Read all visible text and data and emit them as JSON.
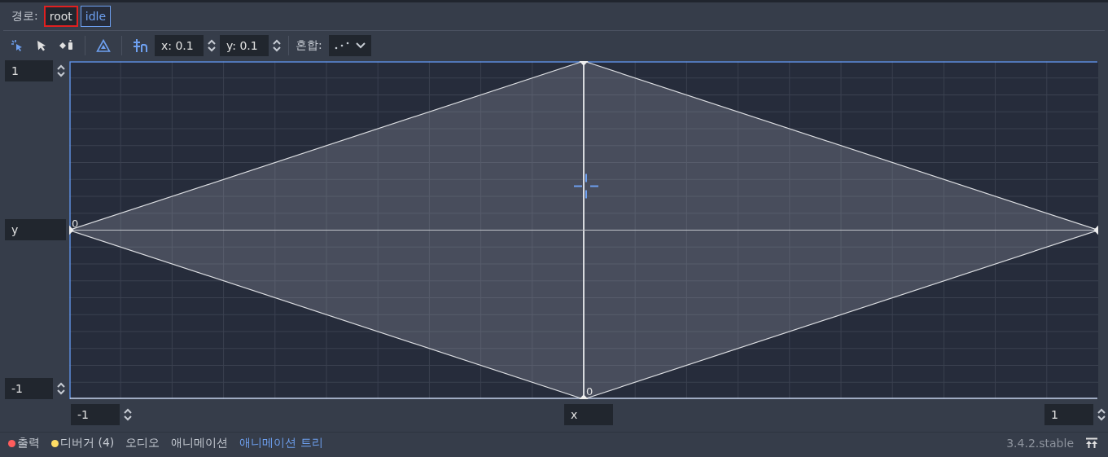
{
  "path": {
    "label": "경로:",
    "items": [
      {
        "text": "root",
        "selected": false,
        "highlighted": true
      },
      {
        "text": "idle",
        "selected": true,
        "highlighted": false
      }
    ]
  },
  "toolbar": {
    "tools": [
      {
        "kind": "select-points",
        "selected": true
      },
      {
        "kind": "pointer",
        "selected": false
      },
      {
        "kind": "add-point",
        "selected": false
      }
    ],
    "triangle_toggle": {
      "on": true
    },
    "snap_toggle": {
      "on": true
    },
    "snap_x": "x: 0.1",
    "snap_y": "y: 0.1",
    "blend_label": "혼합:"
  },
  "y_axis": {
    "max": "1",
    "label": "y",
    "min": "-1"
  },
  "x_axis": {
    "min": "-1",
    "label": "x",
    "max": "1"
  },
  "canvas": {
    "x_zero_label": "0",
    "y_zero_label": "0"
  },
  "bottom_tabs": [
    {
      "label": "출력",
      "selected": false,
      "color": "#ff5d5d"
    },
    {
      "label": "디버거 (4)",
      "selected": false,
      "color": "#ffdd65"
    },
    {
      "label": "오디오",
      "selected": false
    },
    {
      "label": "애니메이션",
      "selected": false
    },
    {
      "label": "애니메이션 트리",
      "selected": true
    }
  ],
  "version": "3.4.2.stable"
}
